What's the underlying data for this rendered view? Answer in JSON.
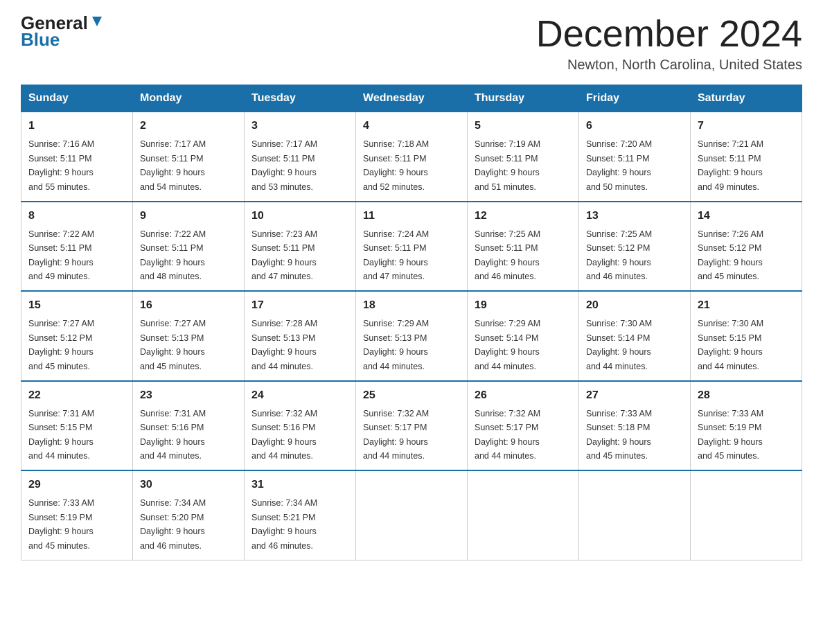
{
  "header": {
    "logo_line1": "General",
    "logo_line2": "Blue",
    "month_title": "December 2024",
    "subtitle": "Newton, North Carolina, United States"
  },
  "weekdays": [
    "Sunday",
    "Monday",
    "Tuesday",
    "Wednesday",
    "Thursday",
    "Friday",
    "Saturday"
  ],
  "weeks": [
    [
      {
        "day": "1",
        "sunrise": "7:16 AM",
        "sunset": "5:11 PM",
        "daylight": "9 hours and 55 minutes."
      },
      {
        "day": "2",
        "sunrise": "7:17 AM",
        "sunset": "5:11 PM",
        "daylight": "9 hours and 54 minutes."
      },
      {
        "day": "3",
        "sunrise": "7:17 AM",
        "sunset": "5:11 PM",
        "daylight": "9 hours and 53 minutes."
      },
      {
        "day": "4",
        "sunrise": "7:18 AM",
        "sunset": "5:11 PM",
        "daylight": "9 hours and 52 minutes."
      },
      {
        "day": "5",
        "sunrise": "7:19 AM",
        "sunset": "5:11 PM",
        "daylight": "9 hours and 51 minutes."
      },
      {
        "day": "6",
        "sunrise": "7:20 AM",
        "sunset": "5:11 PM",
        "daylight": "9 hours and 50 minutes."
      },
      {
        "day": "7",
        "sunrise": "7:21 AM",
        "sunset": "5:11 PM",
        "daylight": "9 hours and 49 minutes."
      }
    ],
    [
      {
        "day": "8",
        "sunrise": "7:22 AM",
        "sunset": "5:11 PM",
        "daylight": "9 hours and 49 minutes."
      },
      {
        "day": "9",
        "sunrise": "7:22 AM",
        "sunset": "5:11 PM",
        "daylight": "9 hours and 48 minutes."
      },
      {
        "day": "10",
        "sunrise": "7:23 AM",
        "sunset": "5:11 PM",
        "daylight": "9 hours and 47 minutes."
      },
      {
        "day": "11",
        "sunrise": "7:24 AM",
        "sunset": "5:11 PM",
        "daylight": "9 hours and 47 minutes."
      },
      {
        "day": "12",
        "sunrise": "7:25 AM",
        "sunset": "5:11 PM",
        "daylight": "9 hours and 46 minutes."
      },
      {
        "day": "13",
        "sunrise": "7:25 AM",
        "sunset": "5:12 PM",
        "daylight": "9 hours and 46 minutes."
      },
      {
        "day": "14",
        "sunrise": "7:26 AM",
        "sunset": "5:12 PM",
        "daylight": "9 hours and 45 minutes."
      }
    ],
    [
      {
        "day": "15",
        "sunrise": "7:27 AM",
        "sunset": "5:12 PM",
        "daylight": "9 hours and 45 minutes."
      },
      {
        "day": "16",
        "sunrise": "7:27 AM",
        "sunset": "5:13 PM",
        "daylight": "9 hours and 45 minutes."
      },
      {
        "day": "17",
        "sunrise": "7:28 AM",
        "sunset": "5:13 PM",
        "daylight": "9 hours and 44 minutes."
      },
      {
        "day": "18",
        "sunrise": "7:29 AM",
        "sunset": "5:13 PM",
        "daylight": "9 hours and 44 minutes."
      },
      {
        "day": "19",
        "sunrise": "7:29 AM",
        "sunset": "5:14 PM",
        "daylight": "9 hours and 44 minutes."
      },
      {
        "day": "20",
        "sunrise": "7:30 AM",
        "sunset": "5:14 PM",
        "daylight": "9 hours and 44 minutes."
      },
      {
        "day": "21",
        "sunrise": "7:30 AM",
        "sunset": "5:15 PM",
        "daylight": "9 hours and 44 minutes."
      }
    ],
    [
      {
        "day": "22",
        "sunrise": "7:31 AM",
        "sunset": "5:15 PM",
        "daylight": "9 hours and 44 minutes."
      },
      {
        "day": "23",
        "sunrise": "7:31 AM",
        "sunset": "5:16 PM",
        "daylight": "9 hours and 44 minutes."
      },
      {
        "day": "24",
        "sunrise": "7:32 AM",
        "sunset": "5:16 PM",
        "daylight": "9 hours and 44 minutes."
      },
      {
        "day": "25",
        "sunrise": "7:32 AM",
        "sunset": "5:17 PM",
        "daylight": "9 hours and 44 minutes."
      },
      {
        "day": "26",
        "sunrise": "7:32 AM",
        "sunset": "5:17 PM",
        "daylight": "9 hours and 44 minutes."
      },
      {
        "day": "27",
        "sunrise": "7:33 AM",
        "sunset": "5:18 PM",
        "daylight": "9 hours and 45 minutes."
      },
      {
        "day": "28",
        "sunrise": "7:33 AM",
        "sunset": "5:19 PM",
        "daylight": "9 hours and 45 minutes."
      }
    ],
    [
      {
        "day": "29",
        "sunrise": "7:33 AM",
        "sunset": "5:19 PM",
        "daylight": "9 hours and 45 minutes."
      },
      {
        "day": "30",
        "sunrise": "7:34 AM",
        "sunset": "5:20 PM",
        "daylight": "9 hours and 46 minutes."
      },
      {
        "day": "31",
        "sunrise": "7:34 AM",
        "sunset": "5:21 PM",
        "daylight": "9 hours and 46 minutes."
      },
      null,
      null,
      null,
      null
    ]
  ],
  "labels": {
    "sunrise": "Sunrise:",
    "sunset": "Sunset:",
    "daylight": "Daylight:"
  }
}
